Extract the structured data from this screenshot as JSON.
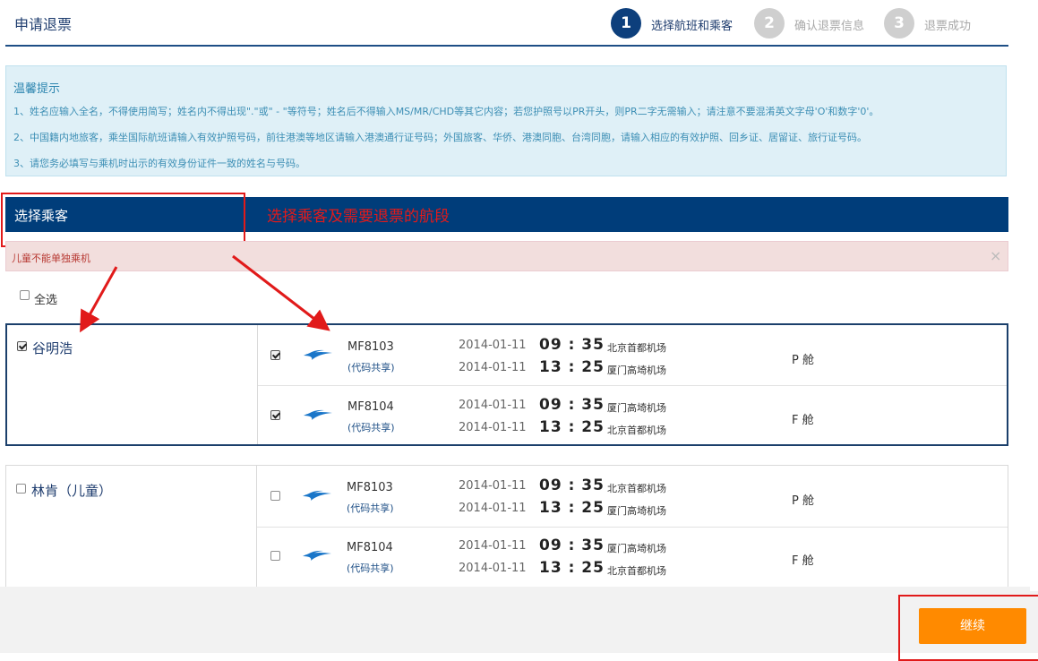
{
  "header": {
    "title": "申请退票",
    "steps": [
      {
        "num": "1",
        "label": "选择航班和乘客"
      },
      {
        "num": "2",
        "label": "确认退票信息"
      },
      {
        "num": "3",
        "label": "退票成功"
      }
    ]
  },
  "notice": {
    "title": "温馨提示",
    "lines": [
      "1、姓名应输入全名，不得使用简写；姓名内不得出现\".\"或\" - \"等符号；姓名后不得输入MS/MR/CHD等其它内容；若您护照号以PR开头，则PR二字无需输入；请注意不要混淆英文字母'O'和数字'0'。",
      "2、中国籍内地旅客，乘坐国际航班请输入有效护照号码，前往港澳等地区请输入港澳通行证号码；外国旅客、华侨、港澳同胞、台湾同胞，请输入相应的有效护照、回乡证、居留证、旅行证号码。",
      "3、请您务必填写与乘机时出示的有效身份证件一致的姓名与号码。"
    ]
  },
  "section": {
    "title": "选择乘客",
    "annotation": "选择乘客及需要退票的航段"
  },
  "alert": {
    "text": "儿童不能单独乘机",
    "close": "×"
  },
  "select_all": "全选",
  "passengers": [
    {
      "name": "谷明浩",
      "checked": true,
      "flights": [
        {
          "flight_no": "MF8103",
          "codeshare": "(代码共享)",
          "date1": "2014-01-11",
          "time1": "09 : 35",
          "airport1": "北京首都机场",
          "date2": "2014-01-11",
          "time2": "13 : 25",
          "airport2": "厦门高埼机场",
          "cabin": "P 舱",
          "checked": true
        },
        {
          "flight_no": "MF8104",
          "codeshare": "(代码共享)",
          "date1": "2014-01-11",
          "time1": "09 : 35",
          "airport1": "厦门高埼机场",
          "date2": "2014-01-11",
          "time2": "13 : 25",
          "airport2": "北京首都机场",
          "cabin": "F 舱",
          "checked": true
        }
      ]
    },
    {
      "name": "林肯（儿童）",
      "checked": false,
      "flights": [
        {
          "flight_no": "MF8103",
          "codeshare": "(代码共享)",
          "date1": "2014-01-11",
          "time1": "09 : 35",
          "airport1": "北京首都机场",
          "date2": "2014-01-11",
          "time2": "13 : 25",
          "airport2": "厦门高埼机场",
          "cabin": "P 舱",
          "checked": false
        },
        {
          "flight_no": "MF8104",
          "codeshare": "(代码共享)",
          "date1": "2014-01-11",
          "time1": "09 : 35",
          "airport1": "厦门高埼机场",
          "date2": "2014-01-11",
          "time2": "13 : 25",
          "airport2": "北京首都机场",
          "cabin": "F 舱",
          "checked": false
        }
      ]
    }
  ],
  "continue_label": "继续",
  "colors": {
    "brand": "#003d7a",
    "accent": "#ff8a00",
    "annotation": "#e11a1a",
    "logo": "#1a76c9"
  }
}
